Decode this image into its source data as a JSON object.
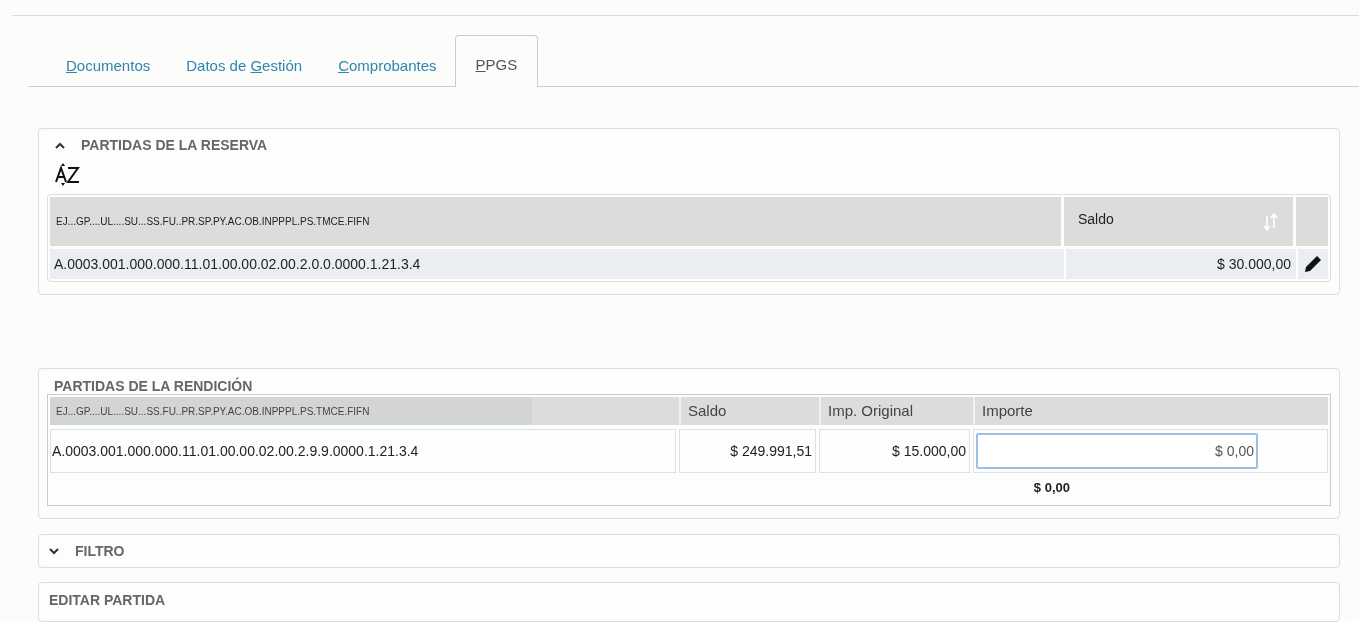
{
  "tabs": [
    {
      "mnemonic": "D",
      "after": "ocumentos",
      "selected": false
    },
    {
      "before": "Datos de ",
      "mnemonic": "G",
      "after": "estión",
      "selected": false
    },
    {
      "mnemonic": "C",
      "after": "omprobantes",
      "selected": false
    },
    {
      "mnemonic": "P",
      "after": "PGS",
      "selected": true
    }
  ],
  "reserva": {
    "title": "PARTIDAS DE LA RESERVA",
    "expanded": true,
    "columns": [
      "EJ...GP....UL....SU...SS.FU..PR.SP.PY.AC.OB.INPPPL.PS.TMCE.FIFN",
      "Saldo"
    ],
    "rows": [
      {
        "partida": "A.0003.001.000.000.11.01.00.00.02.00.2.0.0.0000.1.21.3.4",
        "saldo": "$ 30.000,00",
        "selected": true
      }
    ]
  },
  "rendicion": {
    "title": "PARTIDAS DE LA RENDICIÓN",
    "columns": [
      "EJ...GP....UL....SU...SS.FU..PR.SP.PY.AC.OB.INPPPL.PS.TMCE.FIFN",
      "Saldo",
      "Imp. Original",
      "Importe"
    ],
    "rows": [
      {
        "partida": "A.0003.001.000.000.11.01.00.00.02.00.2.9.9.0000.1.21.3.4",
        "saldo": "$ 249.991,51",
        "original": "$ 15.000,00",
        "importe": "$ 0,00"
      }
    ],
    "total": "$ 0,00"
  },
  "filtro": {
    "title": "FILTRO",
    "expanded": false
  },
  "editar": {
    "title": "EDITAR PARTIDA"
  }
}
